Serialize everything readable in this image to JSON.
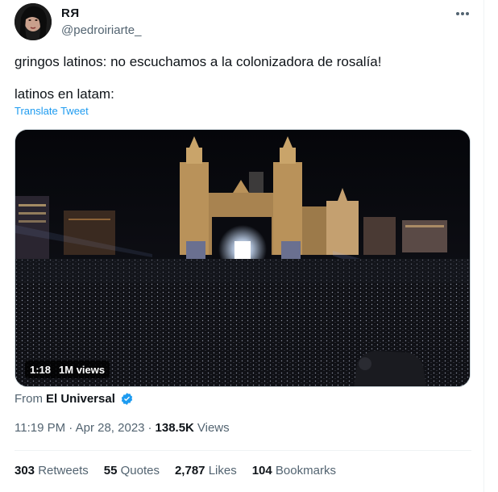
{
  "tweet": {
    "display_name": "RЯ",
    "handle": "@pedroiriarte_",
    "text_line1": "gringos latinos: no escuchamos a la colonizadora de rosalía!",
    "text_line2": "latinos en latam:",
    "translate_label": "Translate Tweet",
    "video": {
      "duration": "1:18",
      "views": "1M views"
    },
    "from_label": "From",
    "source_name": "El Universal",
    "time": "11:19 PM",
    "date": "Apr 28, 2023",
    "separator": "·",
    "views_count": "138.5K",
    "views_label": "Views",
    "stats": [
      {
        "num": "303",
        "label": "Retweets"
      },
      {
        "num": "55",
        "label": "Quotes"
      },
      {
        "num": "2,787",
        "label": "Likes"
      },
      {
        "num": "104",
        "label": "Bookmarks"
      }
    ]
  },
  "colors": {
    "link": "#1d9bf0",
    "secondary": "#536471",
    "primary_text": "#0f1419",
    "verified": "#1d9bf0"
  },
  "icons": [
    "more-icon",
    "verified-icon"
  ]
}
